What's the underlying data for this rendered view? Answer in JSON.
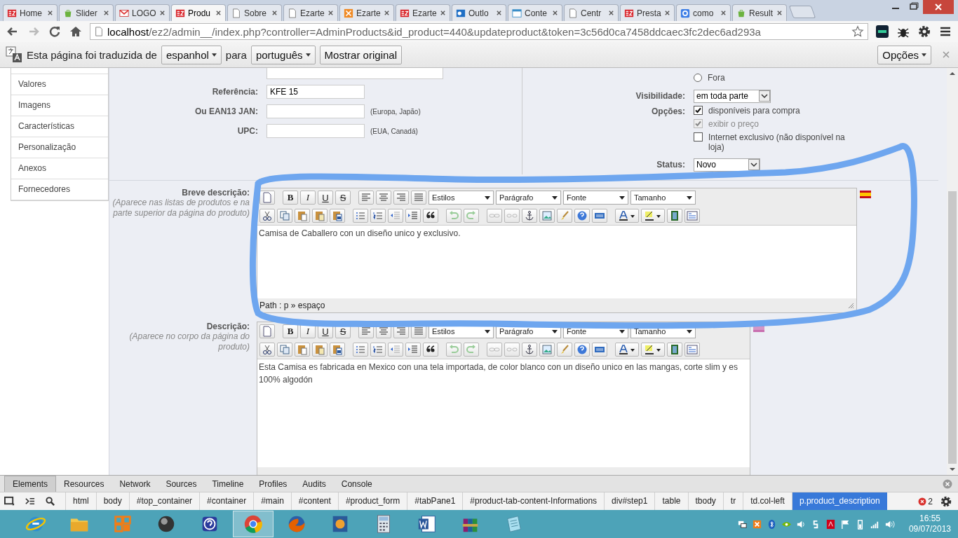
{
  "browser": {
    "tabs": [
      {
        "kind": "stripe",
        "title": "Home",
        "selected": false
      },
      {
        "kind": "bag",
        "title": "Slider",
        "selected": false
      },
      {
        "kind": "envelope",
        "title": "LOGO",
        "selected": false
      },
      {
        "kind": "stripe",
        "title": "Produ",
        "selected": true
      },
      {
        "kind": "page",
        "title": "Sobre",
        "selected": false
      },
      {
        "kind": "page",
        "title": "Ezarte",
        "selected": false
      },
      {
        "kind": "grid",
        "title": "Ezarte",
        "selected": false
      },
      {
        "kind": "stripe",
        "title": "Ezarte",
        "selected": false
      },
      {
        "kind": "mail",
        "title": "Outlo",
        "selected": false
      },
      {
        "kind": "window",
        "title": "Conte",
        "selected": false
      },
      {
        "kind": "page",
        "title": "Centr",
        "selected": false
      },
      {
        "kind": "stripe",
        "title": "Presta",
        "selected": false
      },
      {
        "kind": "square",
        "title": "como",
        "selected": false
      },
      {
        "kind": "bag",
        "title": "Result",
        "selected": false
      }
    ],
    "url": {
      "host": "localhost",
      "path": "/ez2/admin__/index.php?controller=AdminProducts&id_product=440&updateproduct&token=3c56d0ca7458ddcaec3fc2dec6ad293a"
    }
  },
  "translate_bar": {
    "message": "Esta página foi traduzida de",
    "from": "espanhol",
    "joiner": "para",
    "to": "português",
    "show_original": "Mostrar original",
    "options": "Opções"
  },
  "sidebar": {
    "items": [
      "Valores",
      "Imagens",
      "Características",
      "Personalização",
      "Anexos",
      "Fornecedores"
    ]
  },
  "form": {
    "fields": [
      {
        "label": "Referência:",
        "value": "KFE 15"
      },
      {
        "label": "Ou EAN13 JAN:",
        "hint": "(Europa, Japão)"
      },
      {
        "label": "UPC:",
        "hint": "(EUA, Canadá)"
      }
    ],
    "condition_option": {
      "label": "Fora",
      "selected": false
    },
    "visibility": {
      "label": "Visibilidade:",
      "value": "em toda parte"
    },
    "options": {
      "label": "Opções:",
      "items": [
        {
          "label": "disponíveis para compra",
          "checked": true,
          "disabled": false
        },
        {
          "label": "exibir o preço",
          "checked": true,
          "disabled": true
        },
        {
          "label": "Internet exclusivo (não disponível na loja)",
          "checked": false,
          "disabled": false
        }
      ]
    },
    "status": {
      "label": "Status:",
      "value": "Novo"
    }
  },
  "editors": [
    {
      "label": "Breve descrição:",
      "hint": "(Aparece nas listas de produtos e na parte superior da página do produto)",
      "format_buttons": [
        "B",
        "I",
        "U",
        "S"
      ],
      "dropdowns": [
        "Estilos",
        "Parágrafo",
        "Fonte",
        "Tamanho"
      ],
      "content": "Camisa de Caballero con un diseño unico y exclusivo.",
      "path": "Path : p » espaço"
    },
    {
      "label": "Descrição:",
      "hint": "(Aparece no corpo da página do produto)",
      "format_buttons": [
        "B",
        "I",
        "U",
        "S"
      ],
      "dropdowns": [
        "Estilos",
        "Parágrafo",
        "Fonte",
        "Tamanho"
      ],
      "content": "Esta Camisa es fabricada en Mexico con una tela importada, de color blanco con un diseño unico en las mangas, corte slim y es 100% algodón"
    }
  ],
  "devtools": {
    "panels": [
      {
        "label": "Elements",
        "selected": true
      },
      {
        "label": "Resources",
        "selected": false
      },
      {
        "label": "Network",
        "selected": false
      },
      {
        "label": "Sources",
        "selected": false
      },
      {
        "label": "Timeline",
        "selected": false
      },
      {
        "label": "Profiles",
        "selected": false
      },
      {
        "label": "Audits",
        "selected": false
      },
      {
        "label": "Console",
        "selected": false
      }
    ],
    "breadcrumbs": [
      {
        "label": "html",
        "selected": false
      },
      {
        "label": "body",
        "selected": false
      },
      {
        "label": "#top_container",
        "selected": false
      },
      {
        "label": "#container",
        "selected": false
      },
      {
        "label": "#main",
        "selected": false
      },
      {
        "label": "#content",
        "selected": false
      },
      {
        "label": "#product_form",
        "selected": false
      },
      {
        "label": "#tabPane1",
        "selected": false
      },
      {
        "label": "#product-tab-content-Informations",
        "selected": false
      },
      {
        "label": "div#step1",
        "selected": false
      },
      {
        "label": "table",
        "selected": false
      },
      {
        "label": "tbody",
        "selected": false
      },
      {
        "label": "tr",
        "selected": false
      },
      {
        "label": "td.col-left",
        "selected": false
      },
      {
        "label": "p.product_description",
        "selected": true
      }
    ],
    "error_count": "2"
  },
  "taskbar": {
    "apps": [
      {
        "kind": "ie",
        "active": false
      },
      {
        "kind": "folder",
        "active": false
      },
      {
        "kind": "office",
        "active": false
      },
      {
        "kind": "sphere",
        "active": false
      },
      {
        "kind": "help",
        "active": false
      },
      {
        "kind": "chrome",
        "active": true
      },
      {
        "kind": "fox",
        "active": false
      },
      {
        "kind": "media",
        "active": false
      },
      {
        "kind": "calc",
        "active": false
      },
      {
        "kind": "word",
        "active": false
      },
      {
        "kind": "archive",
        "active": false
      },
      {
        "kind": "notepad",
        "active": false
      }
    ],
    "time": "16:55",
    "date": "09/07/2013"
  }
}
